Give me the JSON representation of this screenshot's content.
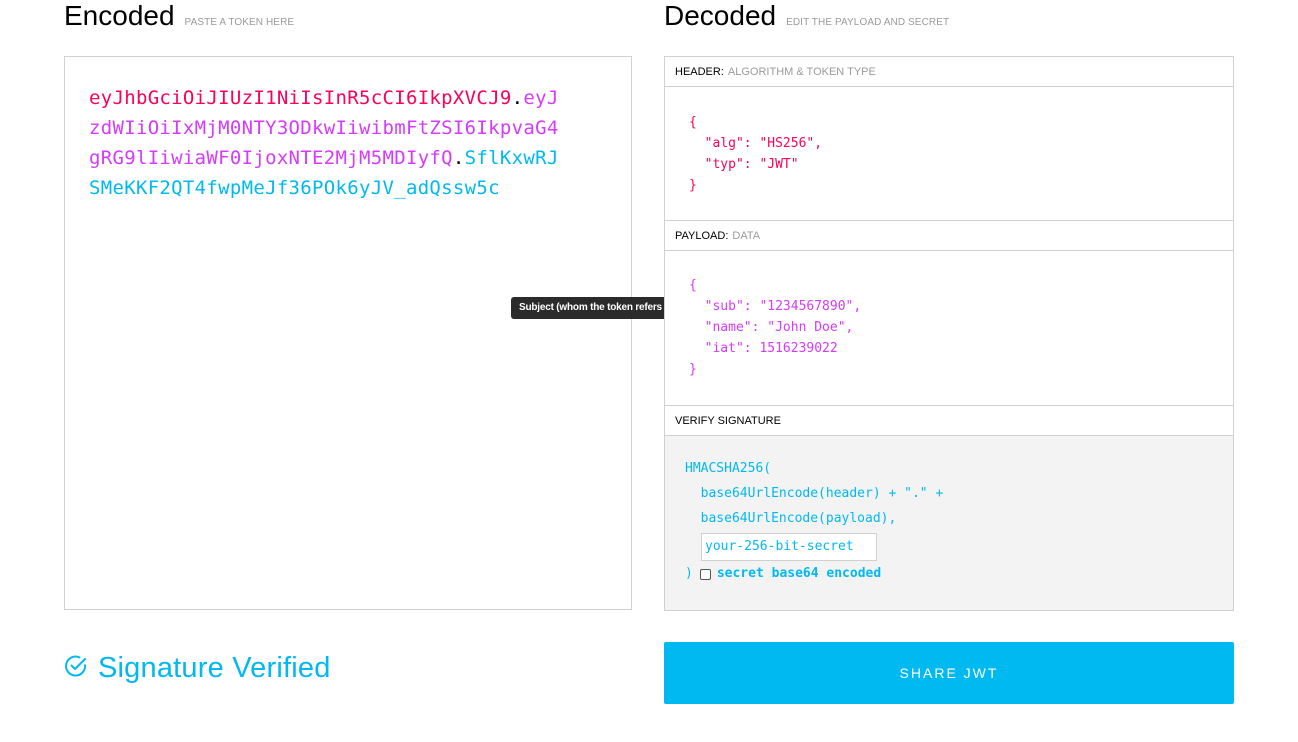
{
  "encoded": {
    "title": "Encoded",
    "subtitle": "PASTE A TOKEN HERE",
    "token": {
      "header": "eyJhbGciOiJIUzI1NiIsInR5cCI6IkpXVCJ9",
      "payload": "eyJzdWIiOiIxMjM0NTY3ODkwIiwibmFtZSI6IkpvaG4gRG9lIiwiaWF0IjoxNTE2MjM5MDIyfQ",
      "signature": "SflKxwRJSMeKKF2QT4fwpMeJf36POk6yJV_adQssw5c",
      "dot": "."
    }
  },
  "tooltip": "Subject (whom the token refers to)",
  "decoded": {
    "title": "Decoded",
    "subtitle": "EDIT THE PAYLOAD AND SECRET",
    "header_section": {
      "label": "HEADER:",
      "label_muted": "ALGORITHM & TOKEN TYPE",
      "lines": [
        "{",
        "  \"alg\": \"HS256\",",
        "  \"typ\": \"JWT\"",
        "}"
      ]
    },
    "payload_section": {
      "label": "PAYLOAD:",
      "label_muted": "DATA",
      "lines": [
        "{",
        "  \"sub\": \"1234567890\",",
        "  \"name\": \"John Doe\",",
        "  \"iat\": 1516239022",
        "}"
      ]
    },
    "verify_section": {
      "label": "VERIFY SIGNATURE",
      "line1": "HMACSHA256(",
      "line2": "  base64UrlEncode(header) + \".\" +",
      "line3": "  base64UrlEncode(payload),",
      "secret_value": "your-256-bit-secret",
      "close": ")",
      "checkbox_label": "secret base64 encoded",
      "checkbox_checked": false
    }
  },
  "status": {
    "label": "Signature Verified",
    "icon": "check-circle-icon"
  },
  "share_button": "SHARE JWT",
  "colors": {
    "header": "#fb015b",
    "payload": "#d63aff",
    "signature": "#00b9f1"
  }
}
